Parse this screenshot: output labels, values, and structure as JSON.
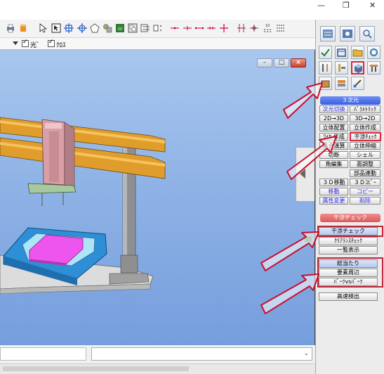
{
  "window": {
    "minimize_glyph": "—",
    "restore_glyph": "❐",
    "close_glyph": "✕"
  },
  "options": {
    "check1_label": "光゛",
    "check2_label": "ｸﾛｽ"
  },
  "viewport": {
    "minimize_glyph": "–",
    "restore_glyph": "□",
    "close_glyph": "×"
  },
  "panel": {
    "header_3d": "３次元",
    "buttons": [
      {
        "id": "zigen-kirikae",
        "label": "次元切換"
      },
      {
        "id": "parametric",
        "label": "ﾊﾟﾗﾒﾄﾘｯｸ"
      },
      {
        "id": "2d-3d",
        "label": "2D→3D"
      },
      {
        "id": "3d-2d",
        "label": "3D→2D"
      },
      {
        "id": "rittai-haichi",
        "label": "立体配置"
      },
      {
        "id": "rittai-sakusei",
        "label": "立体作成"
      },
      {
        "id": "wire-sakusei",
        "label": "ﾜｲﾔ 作成"
      },
      {
        "id": "kansho-check",
        "label": "干渉ﾁｪｯｸ"
      },
      {
        "id": "shugo-enzan",
        "label": "集合演算"
      },
      {
        "id": "rittai-shinshuku",
        "label": "立体伸縮"
      },
      {
        "id": "setsudan",
        "label": "切断"
      },
      {
        "id": "shell",
        "label": "シェル"
      },
      {
        "id": "kado-henshu",
        "label": "角編集"
      },
      {
        "id": "men-chosei",
        "label": "面調整"
      },
      {
        "id": "buhin-rendo",
        "label": "部品連動"
      },
      {
        "id": "3d-ido",
        "label": "３Ｄ移動"
      },
      {
        "id": "3d-copy",
        "label": "３Ｄｺﾋﾟｰ"
      },
      {
        "id": "ido",
        "label": "移動"
      },
      {
        "id": "copy",
        "label": "コピー"
      },
      {
        "id": "zokusei-henko",
        "label": "属性変更"
      },
      {
        "id": "sakujo",
        "label": "削除"
      }
    ],
    "header_kansho": "干渉チェック",
    "kansho_check": "干渉チェック",
    "clearance_check": "ｸﾘｱﾗﾝｽﾁｪｯｸ",
    "ichiran_hyoji": "一覧表示",
    "sokoatari": "総当たり",
    "yoso_shuhen": "要素周辺",
    "parts_vs_parts": "ﾊﾟｰﾂvsﾊﾟｰﾂ",
    "kosoku_kenshutsu": "高速検出"
  },
  "colors": {
    "highlight_red": "#d6263c",
    "arrow_red": "#c8102e",
    "header_blue": "#3c5fe0",
    "header_pink": "#d95a5a"
  }
}
